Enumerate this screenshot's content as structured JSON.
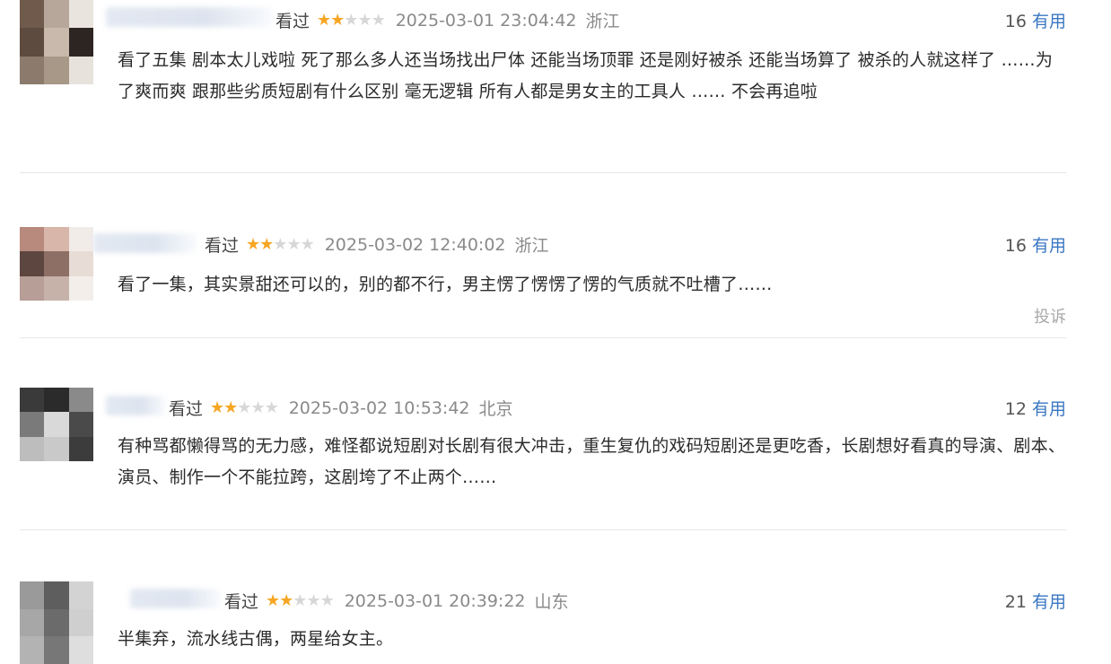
{
  "reviews": [
    {
      "status": "看过",
      "rating": 2,
      "max_rating": 5,
      "date": "2025-03-01 23:04:42",
      "location": "浙江",
      "useful_count": "16",
      "useful_label": "有用",
      "content": "看了五集 剧本太儿戏啦 死了那么多人还当场找出尸体 还能当场顶罪 还是刚好被杀 还能当场算了 被杀的人就这样了 ……为了爽而爽 跟那些劣质短剧有什么区别 毫无逻辑 所有人都是男女主的工具人 …… 不会再追啦"
    },
    {
      "status": "看过",
      "rating": 2,
      "max_rating": 5,
      "date": "2025-03-02 12:40:02",
      "location": "浙江",
      "useful_count": "16",
      "useful_label": "有用",
      "content": "看了一集，其实景甜还可以的，别的都不行，男主愣了愣愣了愣的气质就不吐槽了……",
      "report_label": "投诉"
    },
    {
      "status": "看过",
      "rating": 2,
      "max_rating": 5,
      "date": "2025-03-02 10:53:42",
      "location": "北京",
      "useful_count": "12",
      "useful_label": "有用",
      "content": "有种骂都懒得骂的无力感，难怪都说短剧对长剧有很大冲击，重生复仇的戏码短剧还是更吃香，长剧想好看真的导演、剧本、演员、制作一个不能拉跨，这剧垮了不止两个……"
    },
    {
      "status": "看过",
      "rating": 2,
      "max_rating": 5,
      "date": "2025-03-01 20:39:22",
      "location": "山东",
      "useful_count": "21",
      "useful_label": "有用",
      "content": "半集弃，流水线古偶，两星给女主。"
    }
  ],
  "colors": {
    "star_on": "#f6a623",
    "star_off": "#d7d7d7",
    "useful_link": "#3a77c2",
    "meta_gray": "#8a8a8a"
  }
}
